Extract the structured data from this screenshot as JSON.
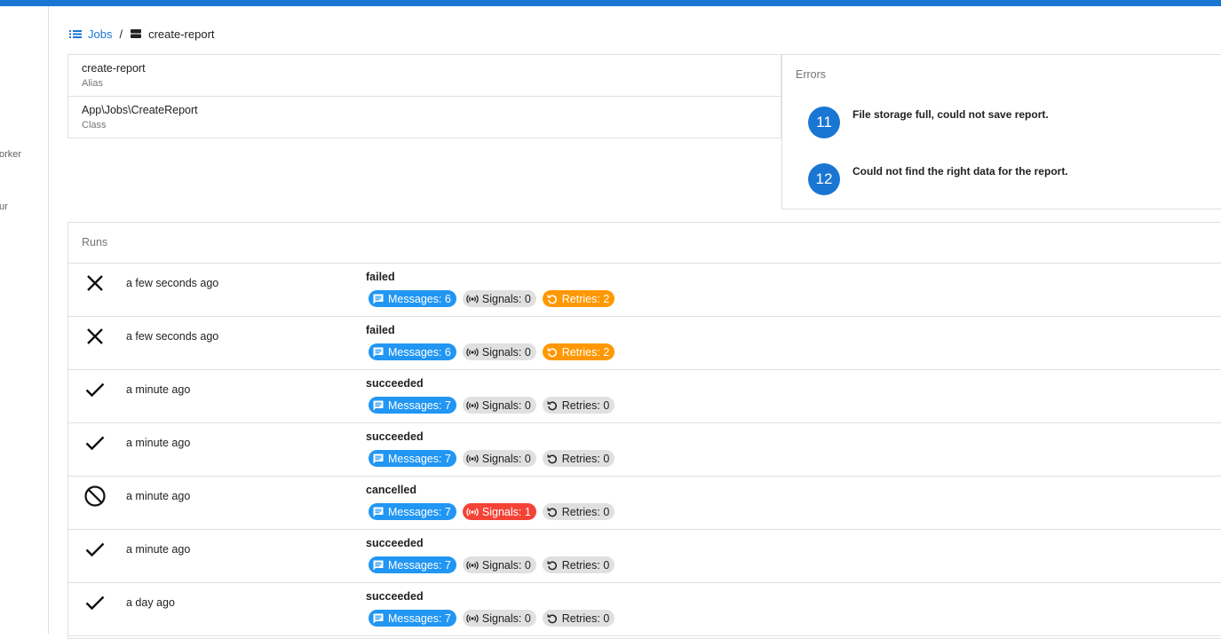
{
  "sidebar": {
    "items": [
      {
        "label": "orker"
      },
      {
        "label": "ur"
      }
    ]
  },
  "breadcrumb": {
    "jobs_label": "Jobs",
    "separator": "/",
    "current_label": "create-report"
  },
  "details": [
    {
      "value": "create-report",
      "label": "Alias"
    },
    {
      "value": "App\\Jobs\\CreateReport",
      "label": "Class"
    }
  ],
  "errors": {
    "title": "Errors",
    "items": [
      {
        "count": "11",
        "message": "File storage full, could not save report."
      },
      {
        "count": "12",
        "message": "Could not find the right data for the report."
      }
    ]
  },
  "runs": {
    "title": "Runs",
    "items": [
      {
        "icon": "close-icon",
        "time": "a few seconds ago",
        "status": "failed",
        "messages": "Messages: 6",
        "signals": "Signals: 0",
        "retries": "Retries: 2"
      },
      {
        "icon": "close-icon",
        "time": "a few seconds ago",
        "status": "failed",
        "messages": "Messages: 6",
        "signals": "Signals: 0",
        "retries": "Retries: 2"
      },
      {
        "icon": "check-icon",
        "time": "a minute ago",
        "status": "succeeded",
        "messages": "Messages: 7",
        "signals": "Signals: 0",
        "retries": "Retries: 0"
      },
      {
        "icon": "check-icon",
        "time": "a minute ago",
        "status": "succeeded",
        "messages": "Messages: 7",
        "signals": "Signals: 0",
        "retries": "Retries: 0"
      },
      {
        "icon": "cancel-icon",
        "time": "a minute ago",
        "status": "cancelled",
        "messages": "Messages: 7",
        "signals": "Signals: 1",
        "retries": "Retries: 0"
      },
      {
        "icon": "check-icon",
        "time": "a minute ago",
        "status": "succeeded",
        "messages": "Messages: 7",
        "signals": "Signals: 0",
        "retries": "Retries: 0"
      },
      {
        "icon": "check-icon",
        "time": "a day ago",
        "status": "succeeded",
        "messages": "Messages: 7",
        "signals": "Signals: 0",
        "retries": "Retries: 0"
      }
    ]
  },
  "colors": {
    "primary": "#1976d2",
    "messages_chip": "#2196f3",
    "warning_chip": "#ff9800",
    "danger_chip": "#f44336",
    "neutral_chip": "#e0e0e0"
  }
}
